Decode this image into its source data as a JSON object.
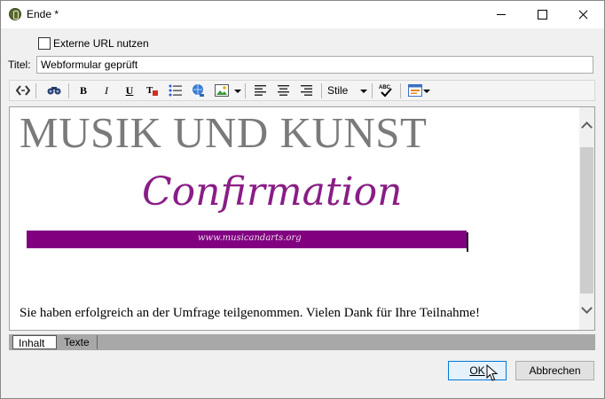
{
  "window": {
    "title": "Ende *"
  },
  "form": {
    "external_url_label": "Externe URL nutzen",
    "external_url_checked": false,
    "title_label": "Titel:",
    "title_value": "Webformular geprüft"
  },
  "toolbar": {
    "styles_label": "Stile",
    "icons": [
      "source-icon",
      "find-icon",
      "bold-icon",
      "italic-icon",
      "underline-icon",
      "text-color-icon",
      "bullet-list-icon",
      "link-icon",
      "image-icon",
      "align-left-icon",
      "align-center-icon",
      "align-right-icon",
      "spellcheck-icon",
      "insert-field-icon"
    ],
    "bold_glyph": "B",
    "italic_glyph": "I",
    "underline_glyph": "U"
  },
  "content": {
    "heading": "MUSIK UND KUNST",
    "banner_script": "Confirmation",
    "banner_url": "www.musicandarts.org",
    "paragraph": "Sie haben erfolgreich an der Umfrage teilgenommen. Vielen Dank für Ihre Teilnahme!"
  },
  "tabs": [
    {
      "label": "Inhalt",
      "active": true
    },
    {
      "label": "Texte",
      "active": false
    }
  ],
  "buttons": {
    "ok": "OK",
    "cancel": "Abbrechen"
  },
  "colors": {
    "banner_bar": "#800080",
    "script_text": "#8a1d86",
    "heading": "#7a7a7a"
  }
}
